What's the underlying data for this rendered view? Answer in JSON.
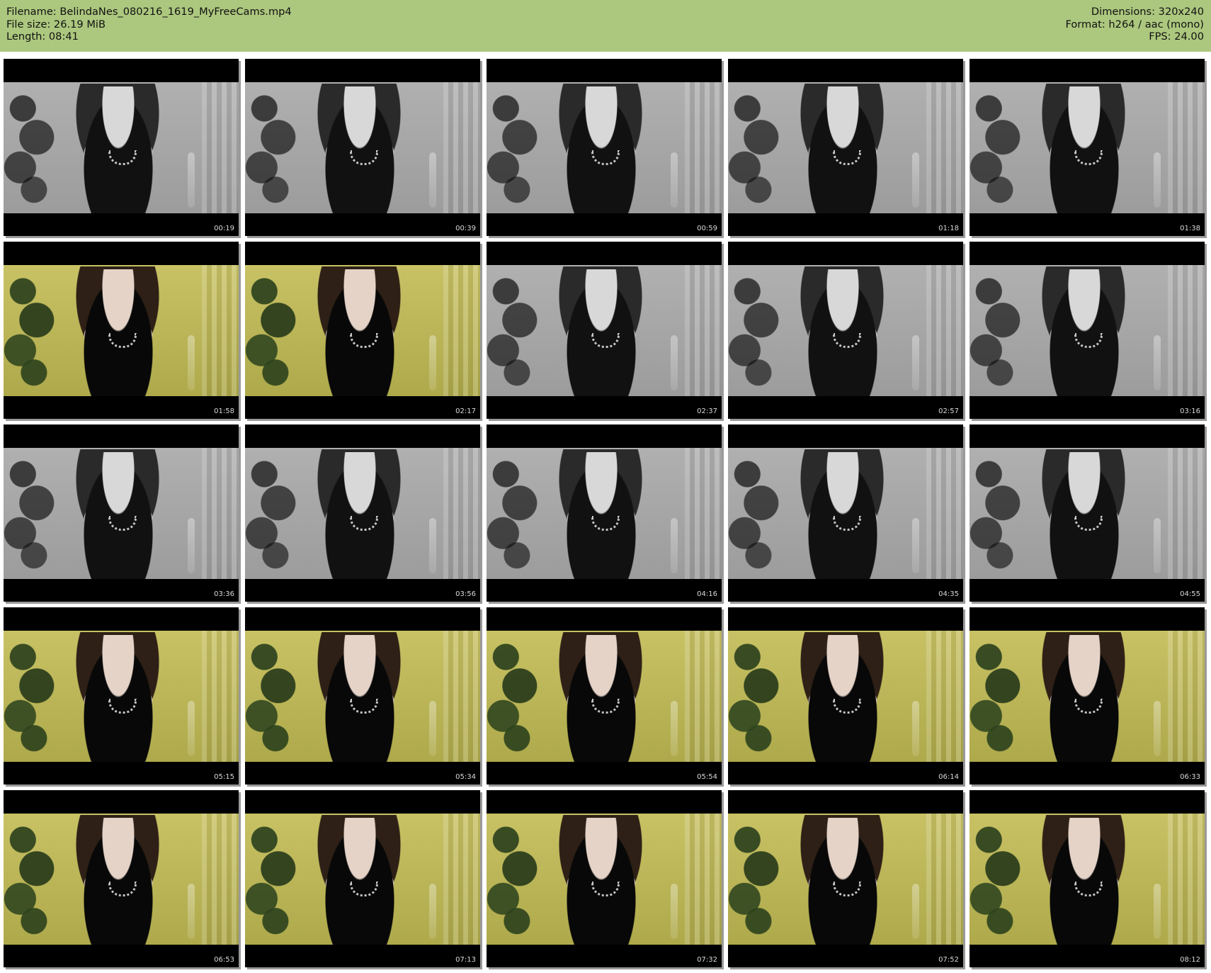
{
  "header": {
    "filename_label": "Filename: BelindaNes_080216_1619_MyFreeCams.mp4",
    "filesize_label": "File size: 26.19 MiB",
    "length_label": "Length: 08:41",
    "dimensions_label": "Dimensions: 320x240",
    "format_label": "Format: h264 / aac (mono)",
    "fps_label": "FPS: 24.00"
  },
  "thumbnails": [
    {
      "time": "00:19",
      "tone": "bw"
    },
    {
      "time": "00:39",
      "tone": "bw"
    },
    {
      "time": "00:59",
      "tone": "bw"
    },
    {
      "time": "01:18",
      "tone": "bw"
    },
    {
      "time": "01:38",
      "tone": "bw"
    },
    {
      "time": "01:58",
      "tone": "color"
    },
    {
      "time": "02:17",
      "tone": "color"
    },
    {
      "time": "02:37",
      "tone": "bw"
    },
    {
      "time": "02:57",
      "tone": "bw"
    },
    {
      "time": "03:16",
      "tone": "bw"
    },
    {
      "time": "03:36",
      "tone": "bw"
    },
    {
      "time": "03:56",
      "tone": "bw"
    },
    {
      "time": "04:16",
      "tone": "bw"
    },
    {
      "time": "04:35",
      "tone": "bw"
    },
    {
      "time": "04:55",
      "tone": "bw"
    },
    {
      "time": "05:15",
      "tone": "color"
    },
    {
      "time": "05:34",
      "tone": "color"
    },
    {
      "time": "05:54",
      "tone": "color"
    },
    {
      "time": "06:14",
      "tone": "color"
    },
    {
      "time": "06:33",
      "tone": "color"
    },
    {
      "time": "06:53",
      "tone": "color"
    },
    {
      "time": "07:13",
      "tone": "color"
    },
    {
      "time": "07:32",
      "tone": "color"
    },
    {
      "time": "07:52",
      "tone": "color"
    },
    {
      "time": "08:12",
      "tone": "color"
    }
  ]
}
